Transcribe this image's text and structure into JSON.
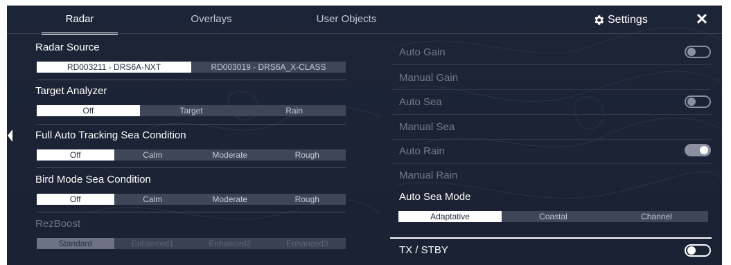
{
  "tabs": [
    {
      "label": "Radar"
    },
    {
      "label": "Overlays"
    },
    {
      "label": "User Objects"
    }
  ],
  "header": {
    "settings_label": "Settings",
    "close_symbol": "✕"
  },
  "left": {
    "radar_source": {
      "label": "Radar Source",
      "options": [
        "RD003211 - DRS6A-NXT",
        "RD003019 - DRS6A_X-CLASS"
      ],
      "selected": "RD003211 - DRS6A-NXT"
    },
    "target_analyzer": {
      "label": "Target Analyzer",
      "options": [
        "Off",
        "Target",
        "Rain"
      ],
      "selected": "Off"
    },
    "full_auto_tracking": {
      "label": "Full Auto Tracking Sea Condition",
      "options": [
        "Off",
        "Calm",
        "Moderate",
        "Rough"
      ],
      "selected": "Off"
    },
    "bird_mode": {
      "label": "Bird Mode Sea Condition",
      "options": [
        "Off",
        "Calm",
        "Moderate",
        "Rough"
      ],
      "selected": "Off"
    },
    "rezboost": {
      "label": "RezBoost",
      "options": [
        "Standard",
        "Enhanced1",
        "Enhanced2",
        "Enhanced3"
      ],
      "selected": "Standard",
      "disabled": true
    }
  },
  "right": {
    "auto_gain": {
      "label": "Auto Gain",
      "state": "off"
    },
    "manual_gain": {
      "label": "Manual Gain"
    },
    "auto_sea": {
      "label": "Auto Sea",
      "state": "off"
    },
    "manual_sea": {
      "label": "Manual Sea"
    },
    "auto_rain": {
      "label": "Auto Rain",
      "state": "on"
    },
    "manual_rain": {
      "label": "Manual Rain"
    },
    "auto_sea_mode": {
      "label": "Auto Sea Mode",
      "options": [
        "Adaptative",
        "Coastal",
        "Channel"
      ],
      "selected": "Adaptative"
    },
    "tx_stby": {
      "label": "TX / STBY",
      "state": "off"
    }
  },
  "icons": {
    "settings": "gear-icon",
    "close": "close-icon",
    "prev": "chevron-left-icon",
    "next": "chevron-right-icon"
  },
  "colors": {
    "background": "#1c2437",
    "selected_segment": "#ffffff",
    "segment": "#3e4658"
  }
}
